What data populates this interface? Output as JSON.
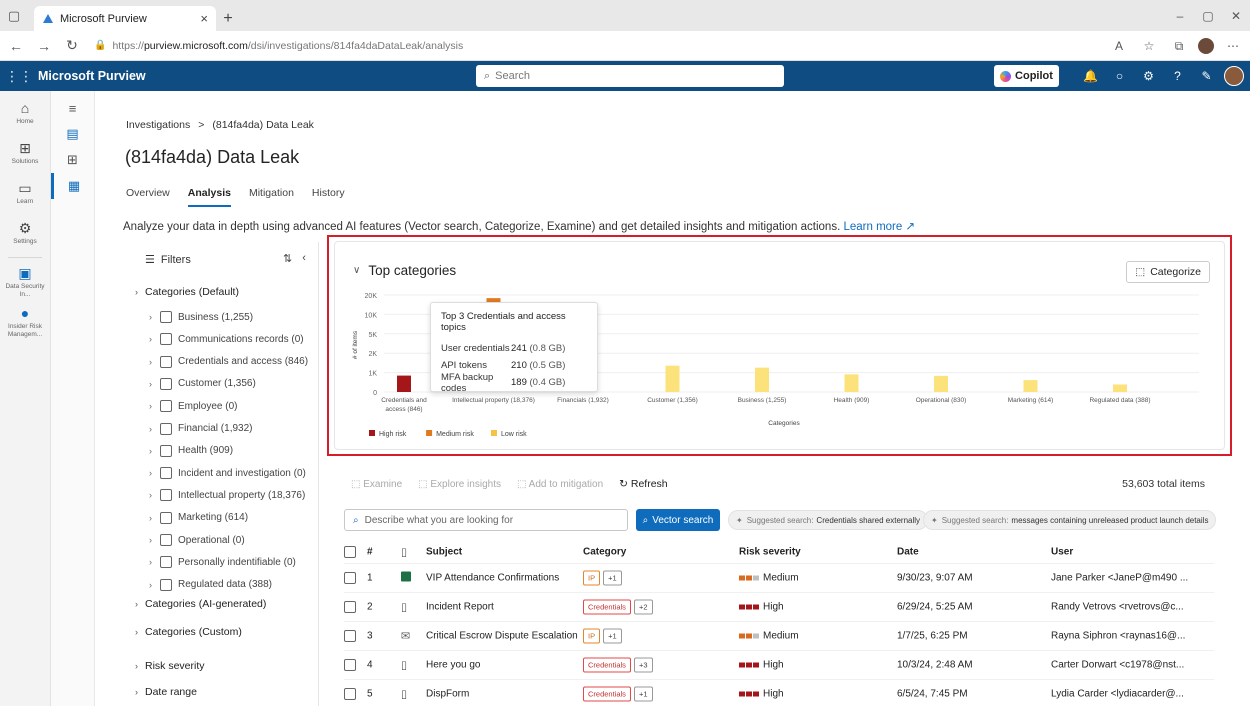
{
  "browser": {
    "tab_title": "Microsoft Purview",
    "url_prefix": "https://",
    "url_host": "purview.microsoft.com",
    "url_path": "/dsi/investigations/814fa4daDataLeak/analysis"
  },
  "app": {
    "title": "Microsoft Purview",
    "search_placeholder": "Search",
    "copilot_label": "Copilot"
  },
  "rail": [
    {
      "label": "Home",
      "icon": "home-icon"
    },
    {
      "label": "Solutions",
      "icon": "solutions-icon"
    },
    {
      "label": "Learn",
      "icon": "learn-icon"
    },
    {
      "label": "Settings",
      "icon": "settings-icon"
    },
    {
      "label": "Data Security In...",
      "icon": "data-security-icon"
    },
    {
      "label": "Insider Risk Managem...",
      "icon": "insider-risk-icon"
    }
  ],
  "breadcrumb": {
    "root": "Investigations",
    "separator": ">",
    "current": "(814fa4da) Data Leak"
  },
  "page_title": "(814fa4da) Data Leak",
  "tabs": [
    "Overview",
    "Analysis",
    "Mitigation",
    "History"
  ],
  "description": "Analyze your data in depth using advanced AI features (Vector search, Categorize, Examine) and get detailed insights and mitigation actions.",
  "learn_more": "Learn more",
  "filters": {
    "title": "Filters",
    "group_default": "Categories (Default)",
    "items": [
      "Business (1,255)",
      "Communications records (0)",
      "Credentials and access (846)",
      "Customer (1,356)",
      "Employee (0)",
      "Financial (1,932)",
      "Health (909)",
      "Incident and investigation (0)",
      "Intellectual property (18,376)",
      "Marketing (614)",
      "Operational (0)",
      "Personally indentifiable (0)",
      "Regulated data (388)"
    ],
    "groups_after": [
      "Categories (AI-generated)",
      "Categories (Custom)"
    ],
    "groups_bottom": [
      "Risk severity",
      "Date range"
    ]
  },
  "top_categories": {
    "title": "Top categories",
    "categorize_label": "Categorize",
    "tooltip": {
      "title": "Top 3 Credentials and access topics",
      "rows": [
        {
          "name": "User credentials",
          "count": "241",
          "size": "(0.8 GB)"
        },
        {
          "name": "API tokens",
          "count": "210",
          "size": "(0.5 GB)"
        },
        {
          "name": "MFA backup codes",
          "count": "189",
          "size": "(0.4 GB)"
        }
      ]
    }
  },
  "chart_data": {
    "type": "bar",
    "ylabel": "# of items",
    "xlabel": "Categories",
    "yticks": [
      "20K",
      "10K",
      "5K",
      "2K",
      "1K",
      "0"
    ],
    "categories": [
      "Credentials and access (846)",
      "Intellectual property (18,376)",
      "Financials (1,932)",
      "Customer (1,356)",
      "Business (1,255)",
      "Health (909)",
      "Operational (830)",
      "Marketing (614)",
      "Regulated data (388)"
    ],
    "values": [
      846,
      18376,
      1932,
      1356,
      1255,
      909,
      830,
      614,
      388
    ],
    "risk": [
      "high",
      "medium",
      "low",
      "low",
      "low",
      "low",
      "low",
      "low",
      "low"
    ],
    "legend": [
      {
        "name": "High risk",
        "color": "#a4161a"
      },
      {
        "name": "Medium risk",
        "color": "#e07a1f"
      },
      {
        "name": "Low risk",
        "color": "#f5c242"
      }
    ],
    "bar_colors": {
      "high": "#a4161a",
      "medium": "#e07a1f",
      "low": "#fbe27a"
    }
  },
  "results": {
    "actions": [
      "Examine",
      "Explore insights",
      "Add to mitigation"
    ],
    "refresh": "Refresh",
    "total": "53,603 total items",
    "query_placeholder": "Describe what you are looking for",
    "vector_search": "Vector search",
    "suggestions": [
      {
        "prefix": "Suggested search:",
        "text": "Credentials shared externally"
      },
      {
        "prefix": "Suggested search:",
        "text": "messages containing unreleased product launch details"
      }
    ],
    "columns": [
      "#",
      "Subject",
      "Category",
      "Risk severity",
      "Date",
      "User"
    ],
    "rows": [
      {
        "num": "1",
        "icon": "excel-icon",
        "subject": "VIP Attendance Confirmations",
        "tag": "IP",
        "more": "+1",
        "risk": "Medium",
        "date": "9/30/23, 9:07 AM",
        "user": "Jane Parker <JaneP@m490 ..."
      },
      {
        "num": "2",
        "icon": "document-icon",
        "subject": "Incident Report",
        "tag": "Credentials",
        "more": "+2",
        "risk": "High",
        "date": "6/29/24, 5:25 AM",
        "user": "Randy Vetrovs <rvetrovs@c..."
      },
      {
        "num": "3",
        "icon": "email-icon",
        "subject": "Critical Escrow Dispute Escalation",
        "tag": "IP",
        "more": "+1",
        "risk": "Medium",
        "date": "1/7/25, 6:25 PM",
        "user": "Rayna Siphron <raynas16@..."
      },
      {
        "num": "4",
        "icon": "document-icon",
        "subject": "Here you go",
        "tag": "Credentials",
        "more": "+3",
        "risk": "High",
        "date": "10/3/24, 2:48 AM",
        "user": "Carter Dorwart <c1978@nst..."
      },
      {
        "num": "5",
        "icon": "document-icon",
        "subject": "DispForm",
        "tag": "Credentials",
        "more": "+1",
        "risk": "High",
        "date": "6/5/24, 7:45 PM",
        "user": "Lydia Carder <lydiacarder@..."
      }
    ]
  }
}
